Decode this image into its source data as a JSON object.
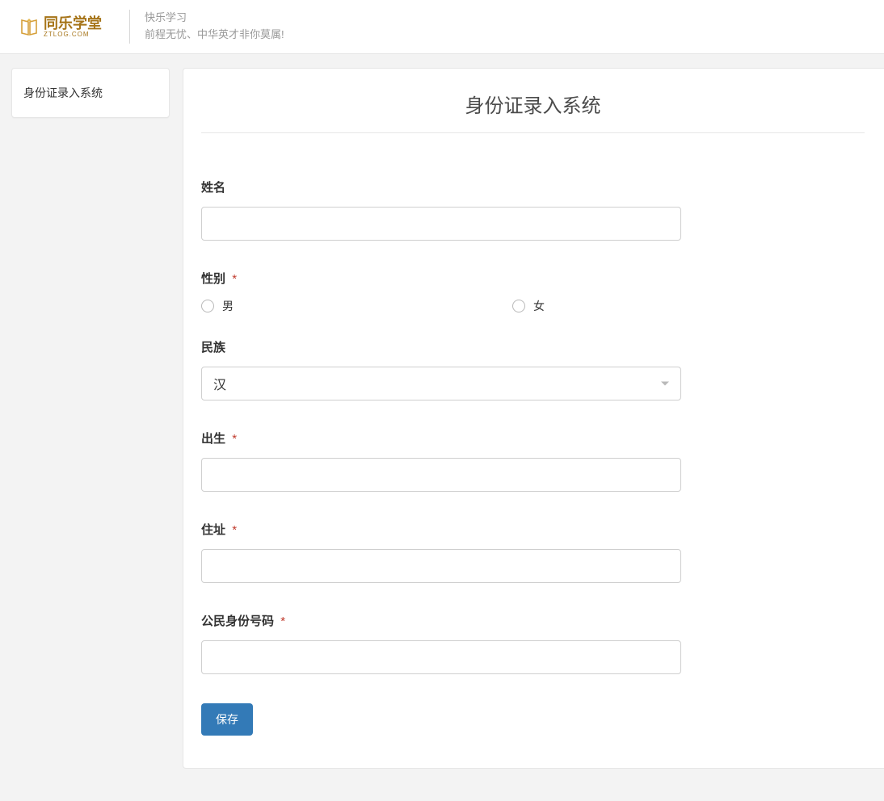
{
  "header": {
    "brand_cn": "同乐学堂",
    "brand_en": "ZTLOG.COM",
    "slogan_line1": "快乐学习",
    "slogan_line2": "前程无忧、中华英才非你莫属!"
  },
  "sidebar": {
    "items": [
      {
        "label": "身份证录入系统"
      }
    ]
  },
  "page": {
    "title": "身份证录入系统"
  },
  "form": {
    "name": {
      "label": "姓名",
      "value": "",
      "required": false
    },
    "gender": {
      "label": "性别",
      "required_mark": "*",
      "options": [
        "男",
        "女"
      ],
      "value": ""
    },
    "ethnicity": {
      "label": "民族",
      "selected": "汉"
    },
    "birth": {
      "label": "出生",
      "required_mark": "*",
      "value": ""
    },
    "address": {
      "label": "住址",
      "required_mark": "*",
      "value": ""
    },
    "id_number": {
      "label": "公民身份号码",
      "required_mark": "*",
      "value": ""
    },
    "save_label": "保存"
  }
}
